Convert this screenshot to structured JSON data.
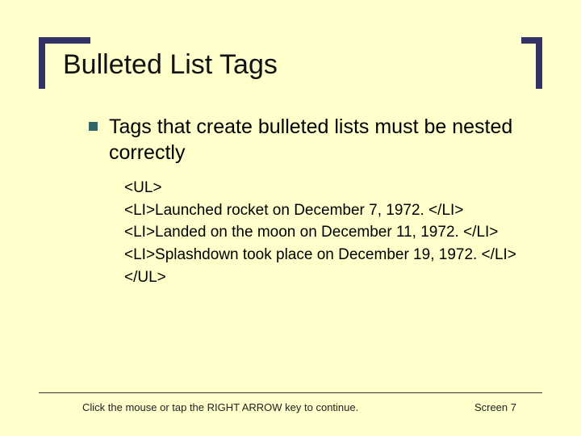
{
  "title": "Bulleted List Tags",
  "lead": "Tags that create bulleted lists must be nested correctly",
  "code_lines": [
    "<UL>",
    "<LI>Launched rocket on December 7, 1972. </LI>",
    "<LI>Landed on the moon on December 11, 1972. </LI>",
    "<LI>Splashdown took place on December 19, 1972. </LI>",
    "</UL>"
  ],
  "footer": {
    "hint": "Click the mouse or tap the RIGHT ARROW key to continue.",
    "screen": "Screen 7"
  }
}
